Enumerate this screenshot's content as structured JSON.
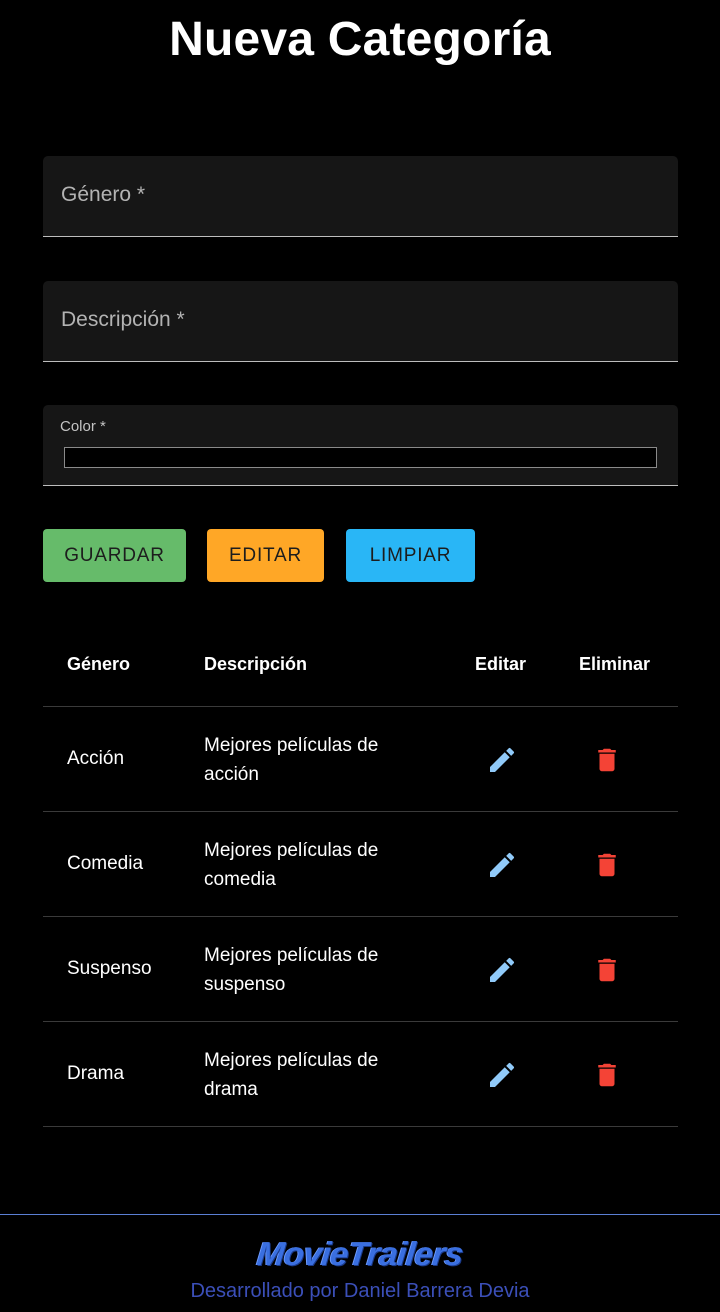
{
  "page": {
    "title": "Nueva Categoría"
  },
  "form": {
    "genero_placeholder": "Género *",
    "descripcion_placeholder": "Descripción *",
    "color_label": "Color *"
  },
  "buttons": {
    "guardar": "GUARDAR",
    "editar": "EDITAR",
    "limpiar": "LIMPIAR"
  },
  "table": {
    "headers": {
      "genero": "Género",
      "descripcion": "Descripción",
      "editar": "Editar",
      "eliminar": "Eliminar"
    },
    "rows": [
      {
        "genero": "Acción",
        "descripcion": "Mejores películas de acción"
      },
      {
        "genero": "Comedia",
        "descripcion": "Mejores películas de comedia"
      },
      {
        "genero": "Suspenso",
        "descripcion": "Mejores películas de suspenso"
      },
      {
        "genero": "Drama",
        "descripcion": "Mejores películas de drama"
      }
    ]
  },
  "footer": {
    "logo_text": "MovieTrailers",
    "credit": "Desarrollado por Daniel Barrera Devia"
  },
  "colors": {
    "guardar": "#66bb6a",
    "editar": "#ffa726",
    "limpiar": "#29b6f6",
    "edit_icon": "#90caf9",
    "delete_icon": "#f44336"
  },
  "icons": {
    "edit": "pencil-icon",
    "delete": "trash-icon"
  }
}
